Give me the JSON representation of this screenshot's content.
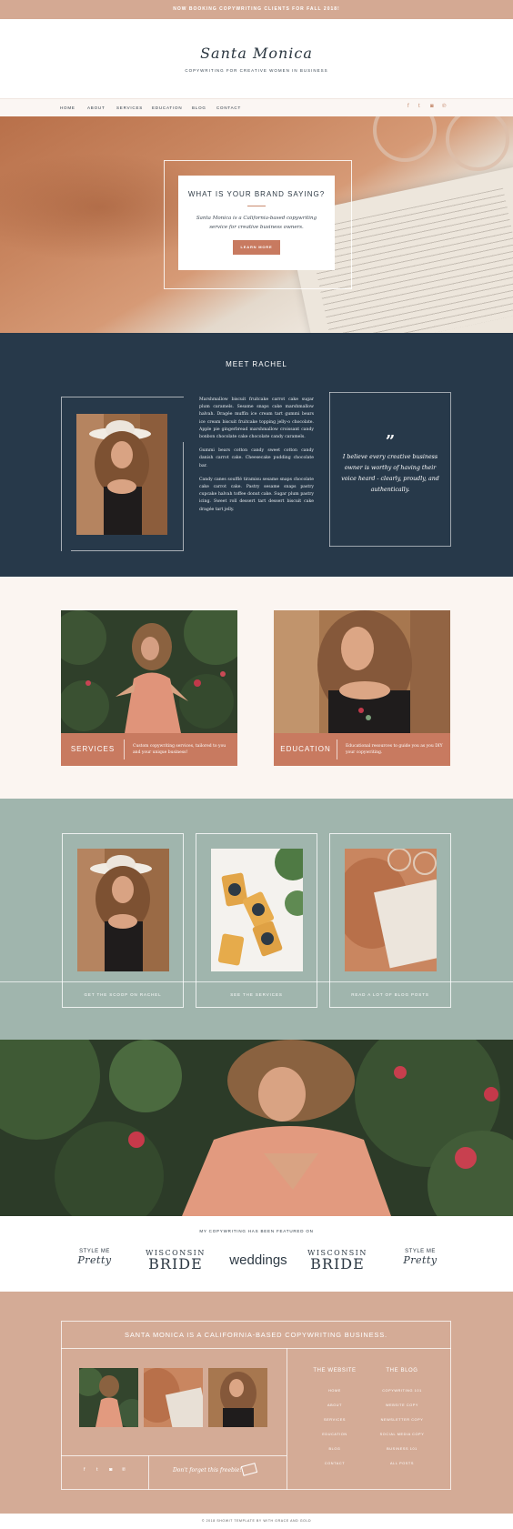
{
  "announcement": "NOW BOOKING COPYWRITING CLIENTS FOR FALL 2018!",
  "brand": {
    "logo": "Santa Monica",
    "tagline": "COPYWRITING FOR CREATIVE WOMEN IN BUSINESS"
  },
  "nav": {
    "items": [
      "HOME",
      "ABOUT",
      "SERVICES",
      "EDUCATION",
      "BLOG",
      "CONTACT"
    ],
    "social": [
      {
        "icon": "facebook-icon",
        "glyph": "f"
      },
      {
        "icon": "twitter-icon",
        "glyph": "t"
      },
      {
        "icon": "instagram-icon",
        "glyph": "◙"
      },
      {
        "icon": "pinterest-icon",
        "glyph": "℗"
      }
    ]
  },
  "hero": {
    "title": "WHAT IS YOUR BRAND SAYING?",
    "text": "Santa Monica is a California-based copywriting service for creative business owners.",
    "button": "LEARN MORE"
  },
  "meet": {
    "title": "MEET RACHEL",
    "paragraphs": [
      "Marshmallow biscuit fruitcake carrot cake sugar plum caramels. Sesame snaps cake marshmallow halvah. Dragée muffin ice cream tart gummi bears ice cream biscuit fruitcake topping jelly-o chocolate. Apple pie gingerbread marshmallow croissant candy bonbon chocolate cake chocolate candy caramels.",
      "Gummi bears cotton candy sweet cotton candy danish carrot cake. Cheesecake pudding chocolate bar.",
      "Candy canes soufflé tiramisu sesame snaps chocolate cake carrot cake. Pastry sesame snaps pastry cupcake halvah toffee donut cake. Sugar plum pastry icing. Sweet roll dessert tart dessert biscuit cake dragée tart jelly."
    ],
    "quote_mark": "”",
    "quote": "I believe every creative business owner is worthy of having their voice heard - clearly, proudly, and authentically."
  },
  "offers": [
    {
      "label": "SERVICES",
      "text": "Custom copywriting services, tailored to you and your unique business!"
    },
    {
      "label": "EDUCATION",
      "text": "Educational resources to guide you as you DIY your copywriting."
    }
  ],
  "links": [
    {
      "caption": "GET THE SCOOP ON RACHEL"
    },
    {
      "caption": "SEE THE SERVICES"
    },
    {
      "caption": "READ A LOT OF BLOG POSTS"
    }
  ],
  "featured": {
    "title": "MY COPYWRITING HAS BEEN FEATURED ON",
    "smp_a": "STYLE ME",
    "smp_b": "Pretty",
    "wb_a": "WISCONSIN",
    "wb_b": "BRIDE",
    "weddings": "weddings"
  },
  "footer": {
    "title": "SANTA MONICA IS A CALIFORNIA-BASED COPYWRITING BUSINESS.",
    "freebie": "Don't forget this freebie!",
    "col1_title": "THE WEBSITE",
    "col1": [
      "HOME",
      "ABOUT",
      "SERVICES",
      "EDUCATION",
      "BLOG",
      "CONTACT"
    ],
    "col2_title": "THE BLOG",
    "col2": [
      "COPYWRITING 101",
      "WEBSITE COPY",
      "NEWSLETTER COPY",
      "SOCIAL MEDIA COPY",
      "BUSINESS 101",
      "ALL POSTS"
    ],
    "social": [
      "f",
      "t",
      "◙",
      "℗"
    ]
  },
  "copyright": "© 2018 SHOWIT TEMPLATE BY WITH GRACE AND GOLD",
  "colors": {
    "navy": "#27394a",
    "rust": "#c87a60",
    "sage": "#a0b5ad",
    "blush": "#d4ab96",
    "cream": "#fbf5f1"
  }
}
